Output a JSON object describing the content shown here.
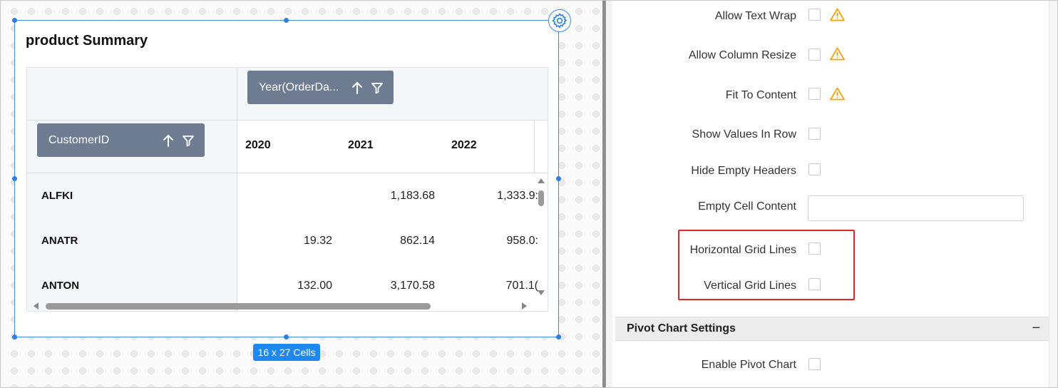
{
  "widget": {
    "title": "product Summary",
    "size_badge": "16 x 27 Cells",
    "column_field": {
      "label": "Year(OrderDa..."
    },
    "row_field": {
      "label": "CustomerID"
    },
    "years": [
      "2020",
      "2021",
      "2022"
    ],
    "rows": [
      {
        "id": "ALFKI",
        "values": [
          "",
          "1,183.68",
          "1,333.9:"
        ]
      },
      {
        "id": "ANATR",
        "values": [
          "19.32",
          "862.14",
          "958.0:"
        ]
      },
      {
        "id": "ANTON",
        "values": [
          "132.00",
          "3,170.58",
          "701.1("
        ]
      }
    ]
  },
  "properties": {
    "allow_text_wrap": "Allow Text Wrap",
    "allow_column_resize": "Allow Column Resize",
    "fit_to_content": "Fit To Content",
    "show_values_in_row": "Show Values In Row",
    "hide_empty_headers": "Hide Empty Headers",
    "empty_cell_content": "Empty Cell Content",
    "horizontal_grid_lines": "Horizontal Grid Lines",
    "vertical_grid_lines": "Vertical Grid Lines",
    "pivot_chart_section": "Pivot Chart Settings",
    "collapse_symbol": "−",
    "enable_pivot_chart": "Enable Pivot Chart"
  },
  "colors": {
    "accent": "#1f87f0",
    "warning": "#f0a30a",
    "highlight": "#e0252b",
    "pill": "#6e7c92"
  }
}
